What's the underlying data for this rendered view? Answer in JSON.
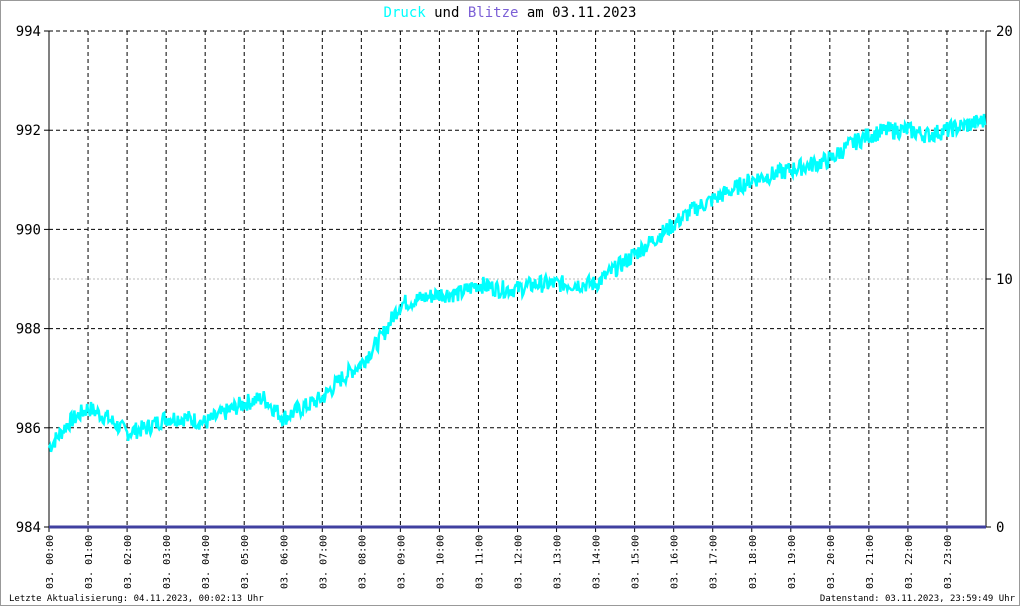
{
  "title": {
    "part1": "Druck",
    "part2": " und ",
    "part3": "Blitze",
    "part4": " am 03.11.2023"
  },
  "colors": {
    "pressure": "#00ffff",
    "lightning": "#7b5fd6",
    "baseline": "#4040a0"
  },
  "footer": {
    "left": "Letzte Aktualisierung: 04.11.2023, 00:02:13 Uhr",
    "right": "Datenstand: 03.11.2023, 23:59:49 Uhr"
  },
  "chart_data": {
    "type": "line",
    "title": "Druck und Blitze am 03.11.2023",
    "x_tick_labels": [
      "03. 00:00",
      "03. 01:00",
      "03. 02:00",
      "03. 03:00",
      "03. 04:00",
      "03. 05:00",
      "03. 06:00",
      "03. 07:00",
      "03. 08:00",
      "03. 09:00",
      "03. 10:00",
      "03. 11:00",
      "03. 12:00",
      "03. 13:00",
      "03. 14:00",
      "03. 15:00",
      "03. 16:00",
      "03. 17:00",
      "03. 18:00",
      "03. 19:00",
      "03. 20:00",
      "03. 21:00",
      "03. 22:00",
      "03. 23:00"
    ],
    "y_left": {
      "range": [
        984,
        994
      ],
      "ticks": [
        "984",
        "986",
        "988",
        "990",
        "992",
        "994"
      ]
    },
    "y_right": {
      "range": [
        0,
        20
      ],
      "ticks": [
        "0",
        "10",
        "20"
      ]
    },
    "grid": true,
    "series": [
      {
        "name": "Druck",
        "x_hours": [
          0,
          0.5,
          1,
          1.5,
          2,
          2.5,
          3,
          3.5,
          4,
          4.5,
          5,
          5.5,
          6,
          6.5,
          7,
          7.5,
          8,
          8.5,
          9,
          9.5,
          10,
          10.5,
          11,
          11.5,
          12,
          12.5,
          13,
          13.5,
          14,
          14.5,
          15,
          15.5,
          16,
          16.5,
          17,
          17.5,
          18,
          18.5,
          19,
          19.5,
          20,
          20.5,
          21,
          21.5,
          22,
          22.5,
          23,
          23.5,
          24
        ],
        "values": [
          985.6,
          986.1,
          986.4,
          986.2,
          985.9,
          986.0,
          986.2,
          986.2,
          986.1,
          986.3,
          986.5,
          986.6,
          986.2,
          986.4,
          986.6,
          987.0,
          987.3,
          987.8,
          988.5,
          988.6,
          988.7,
          988.7,
          988.9,
          988.8,
          988.8,
          988.9,
          988.9,
          988.9,
          988.9,
          989.2,
          989.5,
          989.8,
          990.1,
          990.4,
          990.6,
          990.8,
          991.0,
          991.1,
          991.2,
          991.3,
          991.4,
          991.7,
          991.9,
          992.0,
          992.0,
          991.9,
          992.0,
          992.1,
          992.2
        ]
      },
      {
        "name": "Blitze",
        "x_hours": [],
        "values": []
      }
    ]
  }
}
